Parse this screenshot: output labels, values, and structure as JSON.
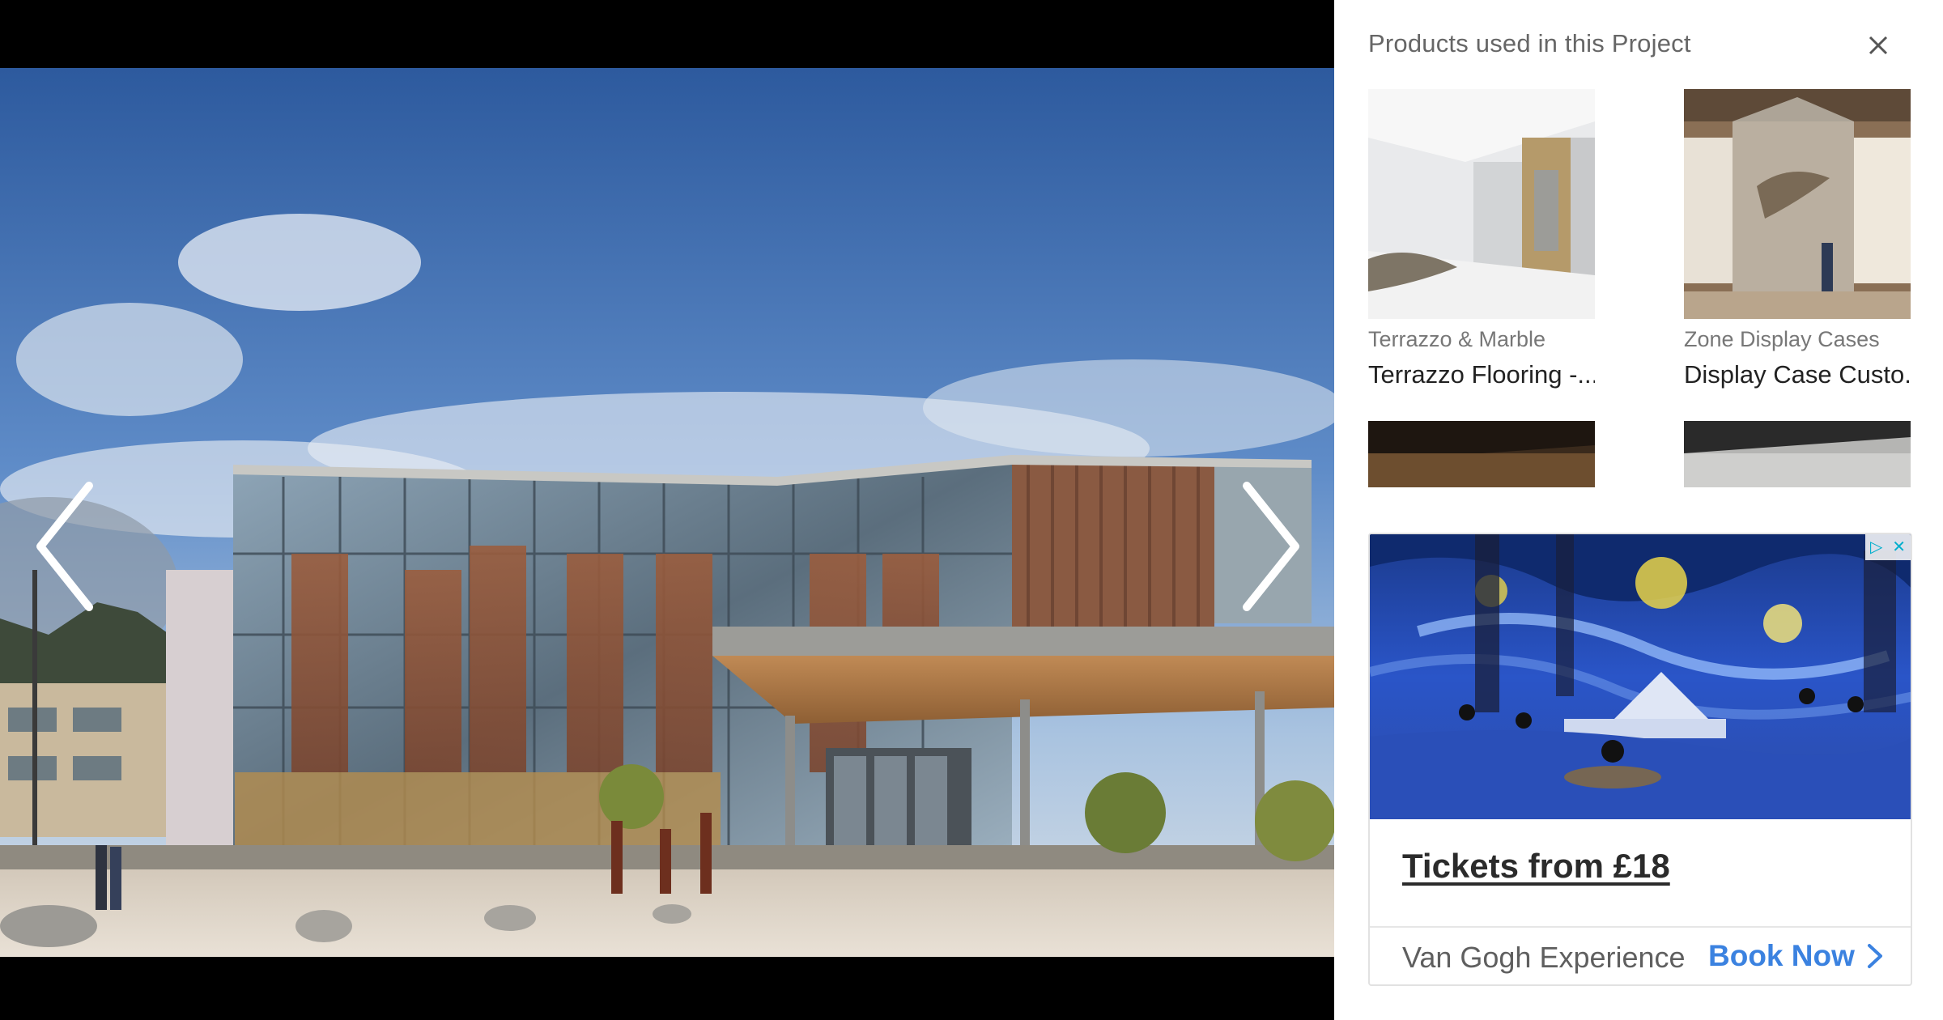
{
  "panel": {
    "title": "Products used in this Project",
    "close_icon": "close-icon"
  },
  "products": [
    {
      "manufacturer": "Terrazzo & Marble",
      "name": "Terrazzo Flooring -..."
    },
    {
      "manufacturer": "Zone Display Cases",
      "name": "Display Case Custo..."
    },
    {
      "manufacturer": "",
      "name": ""
    },
    {
      "manufacturer": "",
      "name": ""
    }
  ],
  "viewer": {
    "prev_icon": "chevron-left-icon",
    "next_icon": "chevron-right-icon"
  },
  "ad": {
    "headline": "Tickets from £18",
    "advertiser": "Van Gogh Experience",
    "cta": "Book Now",
    "cta_icon": "chevron-right-icon",
    "adchoices_icon": "adchoices-icon",
    "adchoices_close": "✕",
    "adchoices_mark": "▷"
  },
  "colors": {
    "cta": "#3b82e0",
    "panel_title": "#666666"
  }
}
